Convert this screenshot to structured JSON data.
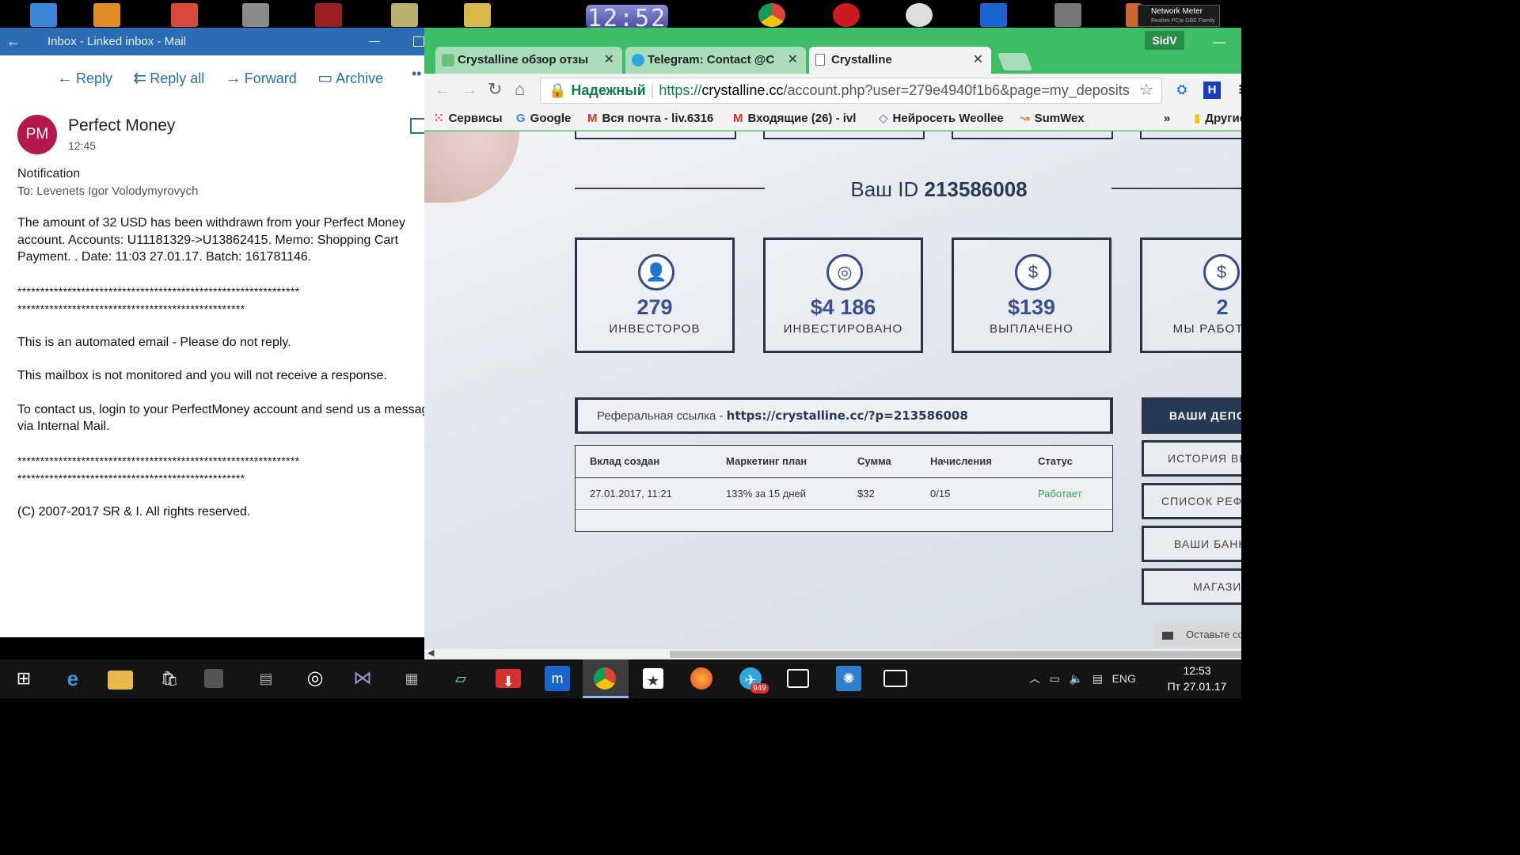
{
  "desktop": {
    "clock_widget": "12:52",
    "network_meter": {
      "title": "Network Meter",
      "subtitle": "Realtek PCIe GBE Family"
    }
  },
  "mail": {
    "window_title": "Inbox - Linked inbox - Mail",
    "toolbar": {
      "reply": "Reply",
      "reply_all": "Reply all",
      "forward": "Forward",
      "archive": "Archive"
    },
    "avatar_initials": "PM",
    "sender": "Perfect Money",
    "time": "12:45",
    "subject": "Notification",
    "to_label": "To:",
    "to_name": "Levenets Igor Volodymyrovych",
    "body": {
      "p1": "The amount of 32 USD has been withdrawn from your Perfect Money account. Accounts: U11181329->U13862415. Memo: Shopping Cart Payment. . Date: 11:03 27.01.17. Batch: 161781146.",
      "stars1": "**************************************************************",
      "stars2": "**************************************************",
      "p2": "This is an automated email - Please do not reply.",
      "p3": "This mailbox is not monitored and you will not receive a response.",
      "p4": "To contact us, login to your PerfectMoney account and send us a message via Internal Mail.",
      "stars3": "**************************************************************",
      "stars4": "**************************************************",
      "p5": "(C) 2007-2017 SR & I. All rights reserved."
    }
  },
  "chrome": {
    "profile": "SidV",
    "tabs": [
      {
        "label": "Crystalline обзор отзывы",
        "active": false
      },
      {
        "label": "Telegram: Contact @Crystalline",
        "active": false
      },
      {
        "label": "Crystalline",
        "active": true
      }
    ],
    "omnibox": {
      "secure_label": "Надежный",
      "scheme": "https://",
      "host": "crystalline.cc",
      "path": "/account.php?user=279e4940f1b6&page=my_deposits"
    },
    "bookmarks": [
      {
        "label": "Сервисы"
      },
      {
        "label": "Google"
      },
      {
        "label": "Вся почта - liv.6316"
      },
      {
        "label": "Входящие (26) - ivl"
      },
      {
        "label": "Нейросеть Weollee"
      },
      {
        "label": "SumWex"
      },
      {
        "label": "Другие"
      }
    ],
    "bookmarks_more": "»"
  },
  "page": {
    "your_id_label": "Ваш ID",
    "your_id": "213586008",
    "stats": [
      {
        "value": "279",
        "label": "ИНВЕСТОРОВ",
        "icon": "investor-icon"
      },
      {
        "value": "$4 186",
        "label": "ИНВЕСТИРОВАНО",
        "icon": "coins-icon"
      },
      {
        "value": "$139",
        "label": "ВЫПЛАЧЕНО",
        "icon": "money-bag-icon"
      },
      {
        "value": "2",
        "label": "МЫ РАБОТАЕМ",
        "icon": "hand-money-icon"
      }
    ],
    "referral_label": "Реферальная ссылка -",
    "referral_link": "https://crystalline.cc/?p=213586008",
    "table": {
      "headers": [
        "Вклад создан",
        "Маркетинг план",
        "Сумма",
        "Начисления",
        "Статус"
      ],
      "rows": [
        [
          "27.01.2017, 11:21",
          "133% за 15 дней",
          "$32",
          "0/15",
          "Работает"
        ]
      ]
    },
    "side_menu": [
      "ВАШИ ДЕПОЗИТЫ",
      "ИСТОРИЯ ВЫПЛАТ",
      "СПИСОК РЕФЕРАЛОВ",
      "ВАШИ БАННЕРЫ",
      "МАГАЗИН"
    ],
    "leave_message": "Оставьте сообщение"
  },
  "taskbar": {
    "language": "ENG",
    "time": "12:53",
    "date": "Пт 27.01.17",
    "telegram_badge": "949"
  },
  "colors": {
    "mail_accent": "#2b6cb5",
    "chrome_frame": "#3dbe64",
    "stat_value": "#3d4f90",
    "status_working": "#3aa05a",
    "avatar": "#b5184a"
  }
}
